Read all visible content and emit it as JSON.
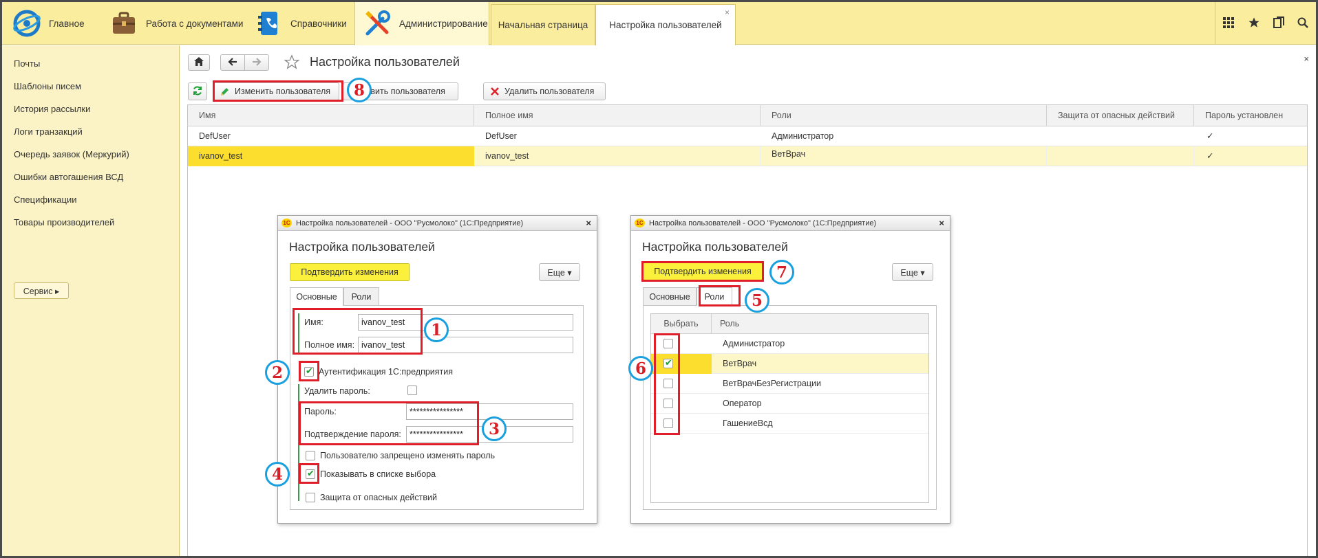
{
  "topbar": {
    "sections": [
      "Главное",
      "Работа с документами",
      "Справочники",
      "Администрирование"
    ],
    "open_tabs": [
      "Начальная страница",
      "Настройка пользователей"
    ],
    "tab_close": "×"
  },
  "leftnav": {
    "items": [
      "Почты",
      "Шаблоны писем",
      "История рассылки",
      "Логи транзакций",
      "Очередь заявок (Меркурий)",
      "Ошибки автогашения ВСД",
      "Спецификации",
      "Товары производителей"
    ],
    "service_label": "Сервис ▸"
  },
  "page": {
    "title": "Настройка пользователей",
    "close": "×",
    "buttons": {
      "edit": "Изменить пользователя",
      "add": "Добавить пользователя",
      "delete": "Удалить пользователя"
    }
  },
  "grid": {
    "columns": [
      "Имя",
      "Полное имя",
      "Роли",
      "Защита от опасных действий",
      "Пароль установлен"
    ],
    "rows": [
      {
        "name": "DefUser",
        "full_name": "DefUser",
        "roles": "Администратор",
        "protection": "",
        "password_set": "✓"
      },
      {
        "name": "ivanov_test",
        "full_name": "ivanov_test",
        "roles": "ВетВрач",
        "protection": "",
        "password_set": "✓"
      }
    ]
  },
  "dialog": {
    "window_title": "Настройка пользователей - ООО \"Русмолоко\"  (1С:Предприятие)",
    "logo": "1С",
    "close": "×",
    "title": "Настройка пользователей",
    "confirm": "Подтвердить изменения",
    "more": "Еще ▾",
    "tabs": [
      "Основные",
      "Роли"
    ],
    "main_tab": {
      "name_label": "Имя:",
      "name_value": "ivanov_test",
      "full_name_label": "Полное имя:",
      "full_name_value": "ivanov_test",
      "auth_label": "Аутентификация 1С:предприятия",
      "delete_password_label": "Удалить пароль:",
      "password_label": "Пароль:",
      "password_value": "****************",
      "confirm_password_label": "Подтверждение пароля:",
      "confirm_password_value": "****************",
      "no_change_password_label": "Пользователю запрещено изменять пароль",
      "show_in_list_label": "Показывать в списке выбора",
      "protection_label": "Защита от опасных действий"
    },
    "roles_tab": {
      "columns": [
        "Выбрать",
        "Роль"
      ],
      "roles": [
        {
          "name": "Администратор",
          "checked": false
        },
        {
          "name": "ВетВрач",
          "checked": true
        },
        {
          "name": "ВетВрачБезРегистрации",
          "checked": false
        },
        {
          "name": "Оператор",
          "checked": false
        },
        {
          "name": "ГашениеВсд",
          "checked": false
        }
      ]
    }
  },
  "annotations": [
    "1",
    "2",
    "3",
    "4",
    "5",
    "6",
    "7",
    "8"
  ],
  "colors": {
    "topbar_bg": "#fbed9e",
    "leftnav_bg": "#fbf3c6",
    "selected_cell": "#fbde2e",
    "confirm_button": "#fbf13c",
    "annotation_red": "#e01e2a",
    "annotation_blue": "#1a9fdf",
    "check_green": "#1aa033"
  }
}
